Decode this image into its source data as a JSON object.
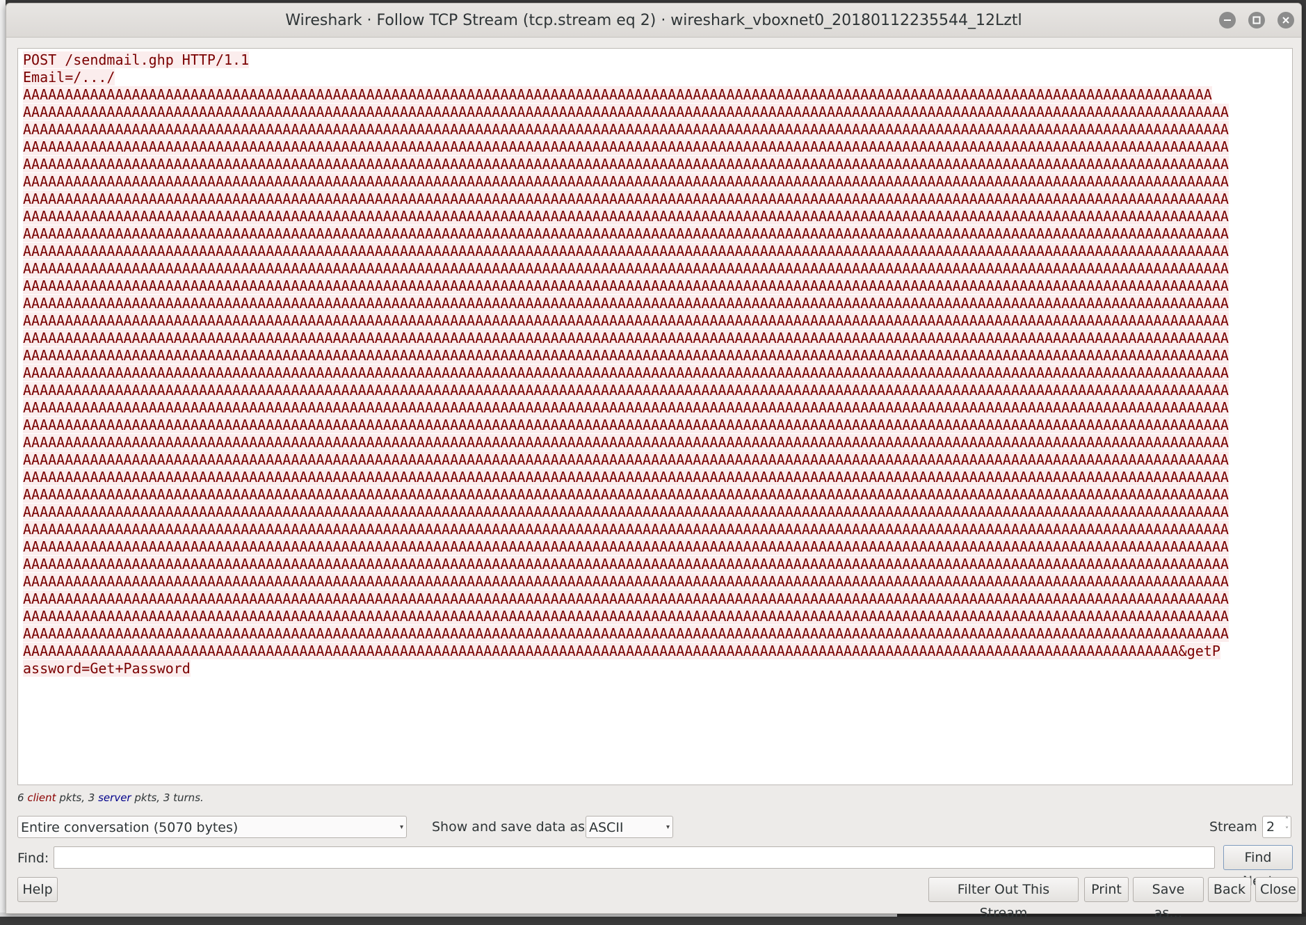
{
  "window": {
    "title": "Wireshark · Follow TCP Stream (tcp.stream eq 2) · wireshark_vboxnet0_20180112235544_12Lztl"
  },
  "stream": {
    "lines": [
      "POST /sendmail.ghp HTTP/1.1",
      "Email=/.../",
      "AAAAAAAAAAAAAAAAAAAAAAAAAAAAAAAAAAAAAAAAAAAAAAAAAAAAAAAAAAAAAAAAAAAAAAAAAAAAAAAAAAAAAAAAAAAAAAAAAAAAAAAAAAAAAAAAAAAAAAAAAAAAAAAAAAAAAAAAAAAAAA",
      "AAAAAAAAAAAAAAAAAAAAAAAAAAAAAAAAAAAAAAAAAAAAAAAAAAAAAAAAAAAAAAAAAAAAAAAAAAAAAAAAAAAAAAAAAAAAAAAAAAAAAAAAAAAAAAAAAAAAAAAAAAAAAAAAAAAAAAAAAAAAAAAA",
      "AAAAAAAAAAAAAAAAAAAAAAAAAAAAAAAAAAAAAAAAAAAAAAAAAAAAAAAAAAAAAAAAAAAAAAAAAAAAAAAAAAAAAAAAAAAAAAAAAAAAAAAAAAAAAAAAAAAAAAAAAAAAAAAAAAAAAAAAAAAAAAAA",
      "AAAAAAAAAAAAAAAAAAAAAAAAAAAAAAAAAAAAAAAAAAAAAAAAAAAAAAAAAAAAAAAAAAAAAAAAAAAAAAAAAAAAAAAAAAAAAAAAAAAAAAAAAAAAAAAAAAAAAAAAAAAAAAAAAAAAAAAAAAAAAAAA",
      "AAAAAAAAAAAAAAAAAAAAAAAAAAAAAAAAAAAAAAAAAAAAAAAAAAAAAAAAAAAAAAAAAAAAAAAAAAAAAAAAAAAAAAAAAAAAAAAAAAAAAAAAAAAAAAAAAAAAAAAAAAAAAAAAAAAAAAAAAAAAAAAA",
      "AAAAAAAAAAAAAAAAAAAAAAAAAAAAAAAAAAAAAAAAAAAAAAAAAAAAAAAAAAAAAAAAAAAAAAAAAAAAAAAAAAAAAAAAAAAAAAAAAAAAAAAAAAAAAAAAAAAAAAAAAAAAAAAAAAAAAAAAAAAAAAAA",
      "AAAAAAAAAAAAAAAAAAAAAAAAAAAAAAAAAAAAAAAAAAAAAAAAAAAAAAAAAAAAAAAAAAAAAAAAAAAAAAAAAAAAAAAAAAAAAAAAAAAAAAAAAAAAAAAAAAAAAAAAAAAAAAAAAAAAAAAAAAAAAAAA",
      "AAAAAAAAAAAAAAAAAAAAAAAAAAAAAAAAAAAAAAAAAAAAAAAAAAAAAAAAAAAAAAAAAAAAAAAAAAAAAAAAAAAAAAAAAAAAAAAAAAAAAAAAAAAAAAAAAAAAAAAAAAAAAAAAAAAAAAAAAAAAAAAA",
      "AAAAAAAAAAAAAAAAAAAAAAAAAAAAAAAAAAAAAAAAAAAAAAAAAAAAAAAAAAAAAAAAAAAAAAAAAAAAAAAAAAAAAAAAAAAAAAAAAAAAAAAAAAAAAAAAAAAAAAAAAAAAAAAAAAAAAAAAAAAAAAAA",
      "AAAAAAAAAAAAAAAAAAAAAAAAAAAAAAAAAAAAAAAAAAAAAAAAAAAAAAAAAAAAAAAAAAAAAAAAAAAAAAAAAAAAAAAAAAAAAAAAAAAAAAAAAAAAAAAAAAAAAAAAAAAAAAAAAAAAAAAAAAAAAAAA",
      "AAAAAAAAAAAAAAAAAAAAAAAAAAAAAAAAAAAAAAAAAAAAAAAAAAAAAAAAAAAAAAAAAAAAAAAAAAAAAAAAAAAAAAAAAAAAAAAAAAAAAAAAAAAAAAAAAAAAAAAAAAAAAAAAAAAAAAAAAAAAAAAA",
      "AAAAAAAAAAAAAAAAAAAAAAAAAAAAAAAAAAAAAAAAAAAAAAAAAAAAAAAAAAAAAAAAAAAAAAAAAAAAAAAAAAAAAAAAAAAAAAAAAAAAAAAAAAAAAAAAAAAAAAAAAAAAAAAAAAAAAAAAAAAAAAAA",
      "AAAAAAAAAAAAAAAAAAAAAAAAAAAAAAAAAAAAAAAAAAAAAAAAAAAAAAAAAAAAAAAAAAAAAAAAAAAAAAAAAAAAAAAAAAAAAAAAAAAAAAAAAAAAAAAAAAAAAAAAAAAAAAAAAAAAAAAAAAAAAAAA",
      "AAAAAAAAAAAAAAAAAAAAAAAAAAAAAAAAAAAAAAAAAAAAAAAAAAAAAAAAAAAAAAAAAAAAAAAAAAAAAAAAAAAAAAAAAAAAAAAAAAAAAAAAAAAAAAAAAAAAAAAAAAAAAAAAAAAAAAAAAAAAAAAA",
      "AAAAAAAAAAAAAAAAAAAAAAAAAAAAAAAAAAAAAAAAAAAAAAAAAAAAAAAAAAAAAAAAAAAAAAAAAAAAAAAAAAAAAAAAAAAAAAAAAAAAAAAAAAAAAAAAAAAAAAAAAAAAAAAAAAAAAAAAAAAAAAAA",
      "AAAAAAAAAAAAAAAAAAAAAAAAAAAAAAAAAAAAAAAAAAAAAAAAAAAAAAAAAAAAAAAAAAAAAAAAAAAAAAAAAAAAAAAAAAAAAAAAAAAAAAAAAAAAAAAAAAAAAAAAAAAAAAAAAAAAAAAAAAAAAAAA",
      "AAAAAAAAAAAAAAAAAAAAAAAAAAAAAAAAAAAAAAAAAAAAAAAAAAAAAAAAAAAAAAAAAAAAAAAAAAAAAAAAAAAAAAAAAAAAAAAAAAAAAAAAAAAAAAAAAAAAAAAAAAAAAAAAAAAAAAAAAAAAAAAA",
      "AAAAAAAAAAAAAAAAAAAAAAAAAAAAAAAAAAAAAAAAAAAAAAAAAAAAAAAAAAAAAAAAAAAAAAAAAAAAAAAAAAAAAAAAAAAAAAAAAAAAAAAAAAAAAAAAAAAAAAAAAAAAAAAAAAAAAAAAAAAAAAAA",
      "AAAAAAAAAAAAAAAAAAAAAAAAAAAAAAAAAAAAAAAAAAAAAAAAAAAAAAAAAAAAAAAAAAAAAAAAAAAAAAAAAAAAAAAAAAAAAAAAAAAAAAAAAAAAAAAAAAAAAAAAAAAAAAAAAAAAAAAAAAAAAAAA",
      "AAAAAAAAAAAAAAAAAAAAAAAAAAAAAAAAAAAAAAAAAAAAAAAAAAAAAAAAAAAAAAAAAAAAAAAAAAAAAAAAAAAAAAAAAAAAAAAAAAAAAAAAAAAAAAAAAAAAAAAAAAAAAAAAAAAAAAAAAAAAAAAA",
      "AAAAAAAAAAAAAAAAAAAAAAAAAAAAAAAAAAAAAAAAAAAAAAAAAAAAAAAAAAAAAAAAAAAAAAAAAAAAAAAAAAAAAAAAAAAAAAAAAAAAAAAAAAAAAAAAAAAAAAAAAAAAAAAAAAAAAAAAAAAAAAAA",
      "AAAAAAAAAAAAAAAAAAAAAAAAAAAAAAAAAAAAAAAAAAAAAAAAAAAAAAAAAAAAAAAAAAAAAAAAAAAAAAAAAAAAAAAAAAAAAAAAAAAAAAAAAAAAAAAAAAAAAAAAAAAAAAAAAAAAAAAAAAAAAAAA",
      "AAAAAAAAAAAAAAAAAAAAAAAAAAAAAAAAAAAAAAAAAAAAAAAAAAAAAAAAAAAAAAAAAAAAAAAAAAAAAAAAAAAAAAAAAAAAAAAAAAAAAAAAAAAAAAAAAAAAAAAAAAAAAAAAAAAAAAAAAAAAAAAA",
      "AAAAAAAAAAAAAAAAAAAAAAAAAAAAAAAAAAAAAAAAAAAAAAAAAAAAAAAAAAAAAAAAAAAAAAAAAAAAAAAAAAAAAAAAAAAAAAAAAAAAAAAAAAAAAAAAAAAAAAAAAAAAAAAAAAAAAAAAAAAAAAAA",
      "AAAAAAAAAAAAAAAAAAAAAAAAAAAAAAAAAAAAAAAAAAAAAAAAAAAAAAAAAAAAAAAAAAAAAAAAAAAAAAAAAAAAAAAAAAAAAAAAAAAAAAAAAAAAAAAAAAAAAAAAAAAAAAAAAAAAAAAAAAAAAAAA",
      "AAAAAAAAAAAAAAAAAAAAAAAAAAAAAAAAAAAAAAAAAAAAAAAAAAAAAAAAAAAAAAAAAAAAAAAAAAAAAAAAAAAAAAAAAAAAAAAAAAAAAAAAAAAAAAAAAAAAAAAAAAAAAAAAAAAAAAAAAAAAAAAA",
      "AAAAAAAAAAAAAAAAAAAAAAAAAAAAAAAAAAAAAAAAAAAAAAAAAAAAAAAAAAAAAAAAAAAAAAAAAAAAAAAAAAAAAAAAAAAAAAAAAAAAAAAAAAAAAAAAAAAAAAAAAAAAAAAAAAAAAAAAAAAAAAAA",
      "AAAAAAAAAAAAAAAAAAAAAAAAAAAAAAAAAAAAAAAAAAAAAAAAAAAAAAAAAAAAAAAAAAAAAAAAAAAAAAAAAAAAAAAAAAAAAAAAAAAAAAAAAAAAAAAAAAAAAAAAAAAAAAAAAAAAAAAAAAAAAAAA",
      "AAAAAAAAAAAAAAAAAAAAAAAAAAAAAAAAAAAAAAAAAAAAAAAAAAAAAAAAAAAAAAAAAAAAAAAAAAAAAAAAAAAAAAAAAAAAAAAAAAAAAAAAAAAAAAAAAAAAAAAAAAAAAAAAAAAAAAAAAAAAAAAA",
      "AAAAAAAAAAAAAAAAAAAAAAAAAAAAAAAAAAAAAAAAAAAAAAAAAAAAAAAAAAAAAAAAAAAAAAAAAAAAAAAAAAAAAAAAAAAAAAAAAAAAAAAAAAAAAAAAAAAAAAAAAAAAAAAAAAAAAAAAAAAAAAAA",
      "AAAAAAAAAAAAAAAAAAAAAAAAAAAAAAAAAAAAAAAAAAAAAAAAAAAAAAAAAAAAAAAAAAAAAAAAAAAAAAAAAAAAAAAAAAAAAAAAAAAAAAAAAAAAAAAAAAAAAAAAAAAAAAAAAAAAAAAAAAAAAAAA",
      "AAAAAAAAAAAAAAAAAAAAAAAAAAAAAAAAAAAAAAAAAAAAAAAAAAAAAAAAAAAAAAAAAAAAAAAAAAAAAAAAAAAAAAAAAAAAAAAAAAAAAAAAAAAAAAAAAAAAAAAAAAAAAAAAAAAAAAAAAAAAAAAA",
      "AAAAAAAAAAAAAAAAAAAAAAAAAAAAAAAAAAAAAAAAAAAAAAAAAAAAAAAAAAAAAAAAAAAAAAAAAAAAAAAAAAAAAAAAAAAAAAAAAAAAAAAAAAAAAAAAAAAAAAAAAAAAAAAAAAAAAAAAAA&getP",
      "assword=Get+Password"
    ],
    "text_color": "#7a0000",
    "highlight_color": "#fbeded"
  },
  "stats": {
    "client_count": "6",
    "client_word": "client",
    "client_suffix": "pkts,",
    "server_count": "3",
    "server_word": "server",
    "server_suffix": "pkts, 3 turns."
  },
  "controls": {
    "conversation_select": "Entire conversation (5070 bytes)",
    "show_save_label": "Show and save data as",
    "format_select": "ASCII",
    "stream_label": "Stream",
    "stream_value": "2",
    "find_label": "Find:",
    "find_value": "",
    "find_next_label": "Find Next"
  },
  "buttons": {
    "help": "Help",
    "filter_out": "Filter Out This Stream",
    "print": "Print",
    "save_as": "Save as…",
    "back": "Back",
    "close": "Close"
  }
}
